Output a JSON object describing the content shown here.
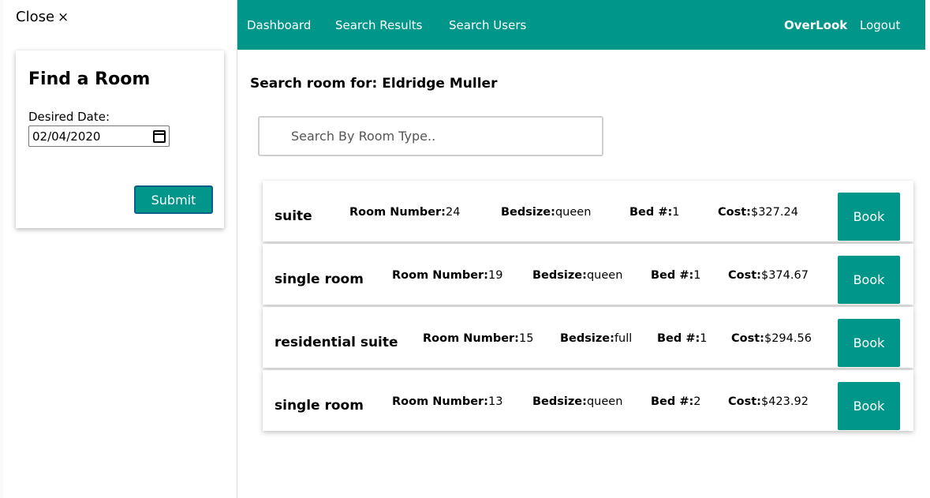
{
  "sidebar": {
    "close_label": "Close",
    "close_icon": "×",
    "find_room": {
      "title": "Find a Room",
      "date_label": "Desired Date:",
      "date_value": "02/04/2020",
      "submit_label": "Submit"
    }
  },
  "nav": {
    "links": [
      "Dashboard",
      "Search Results",
      "Search Users"
    ],
    "brand": "OverLook",
    "logout": "Logout"
  },
  "main": {
    "heading": "Search room for: Eldridge Muller",
    "search_placeholder": "Search By Room Type..",
    "field_labels": {
      "room_number": "Room Number:",
      "bedsize": "Bedsize:",
      "bed_count": "Bed #:",
      "cost": "Cost:"
    },
    "book_label": "Book",
    "rooms": [
      {
        "type": "suite",
        "room_number": "24",
        "bedsize": "queen",
        "bed_count": "1",
        "cost": "$327.24"
      },
      {
        "type": "single room",
        "room_number": "19",
        "bedsize": "queen",
        "bed_count": "1",
        "cost": "$374.67"
      },
      {
        "type": "residential suite",
        "room_number": "15",
        "bedsize": "full",
        "bed_count": "1",
        "cost": "$294.56"
      },
      {
        "type": "single room",
        "room_number": "13",
        "bedsize": "queen",
        "bed_count": "2",
        "cost": "$423.92"
      }
    ]
  },
  "colors": {
    "accent": "#00968a",
    "submit_border": "#0a5f8a"
  }
}
